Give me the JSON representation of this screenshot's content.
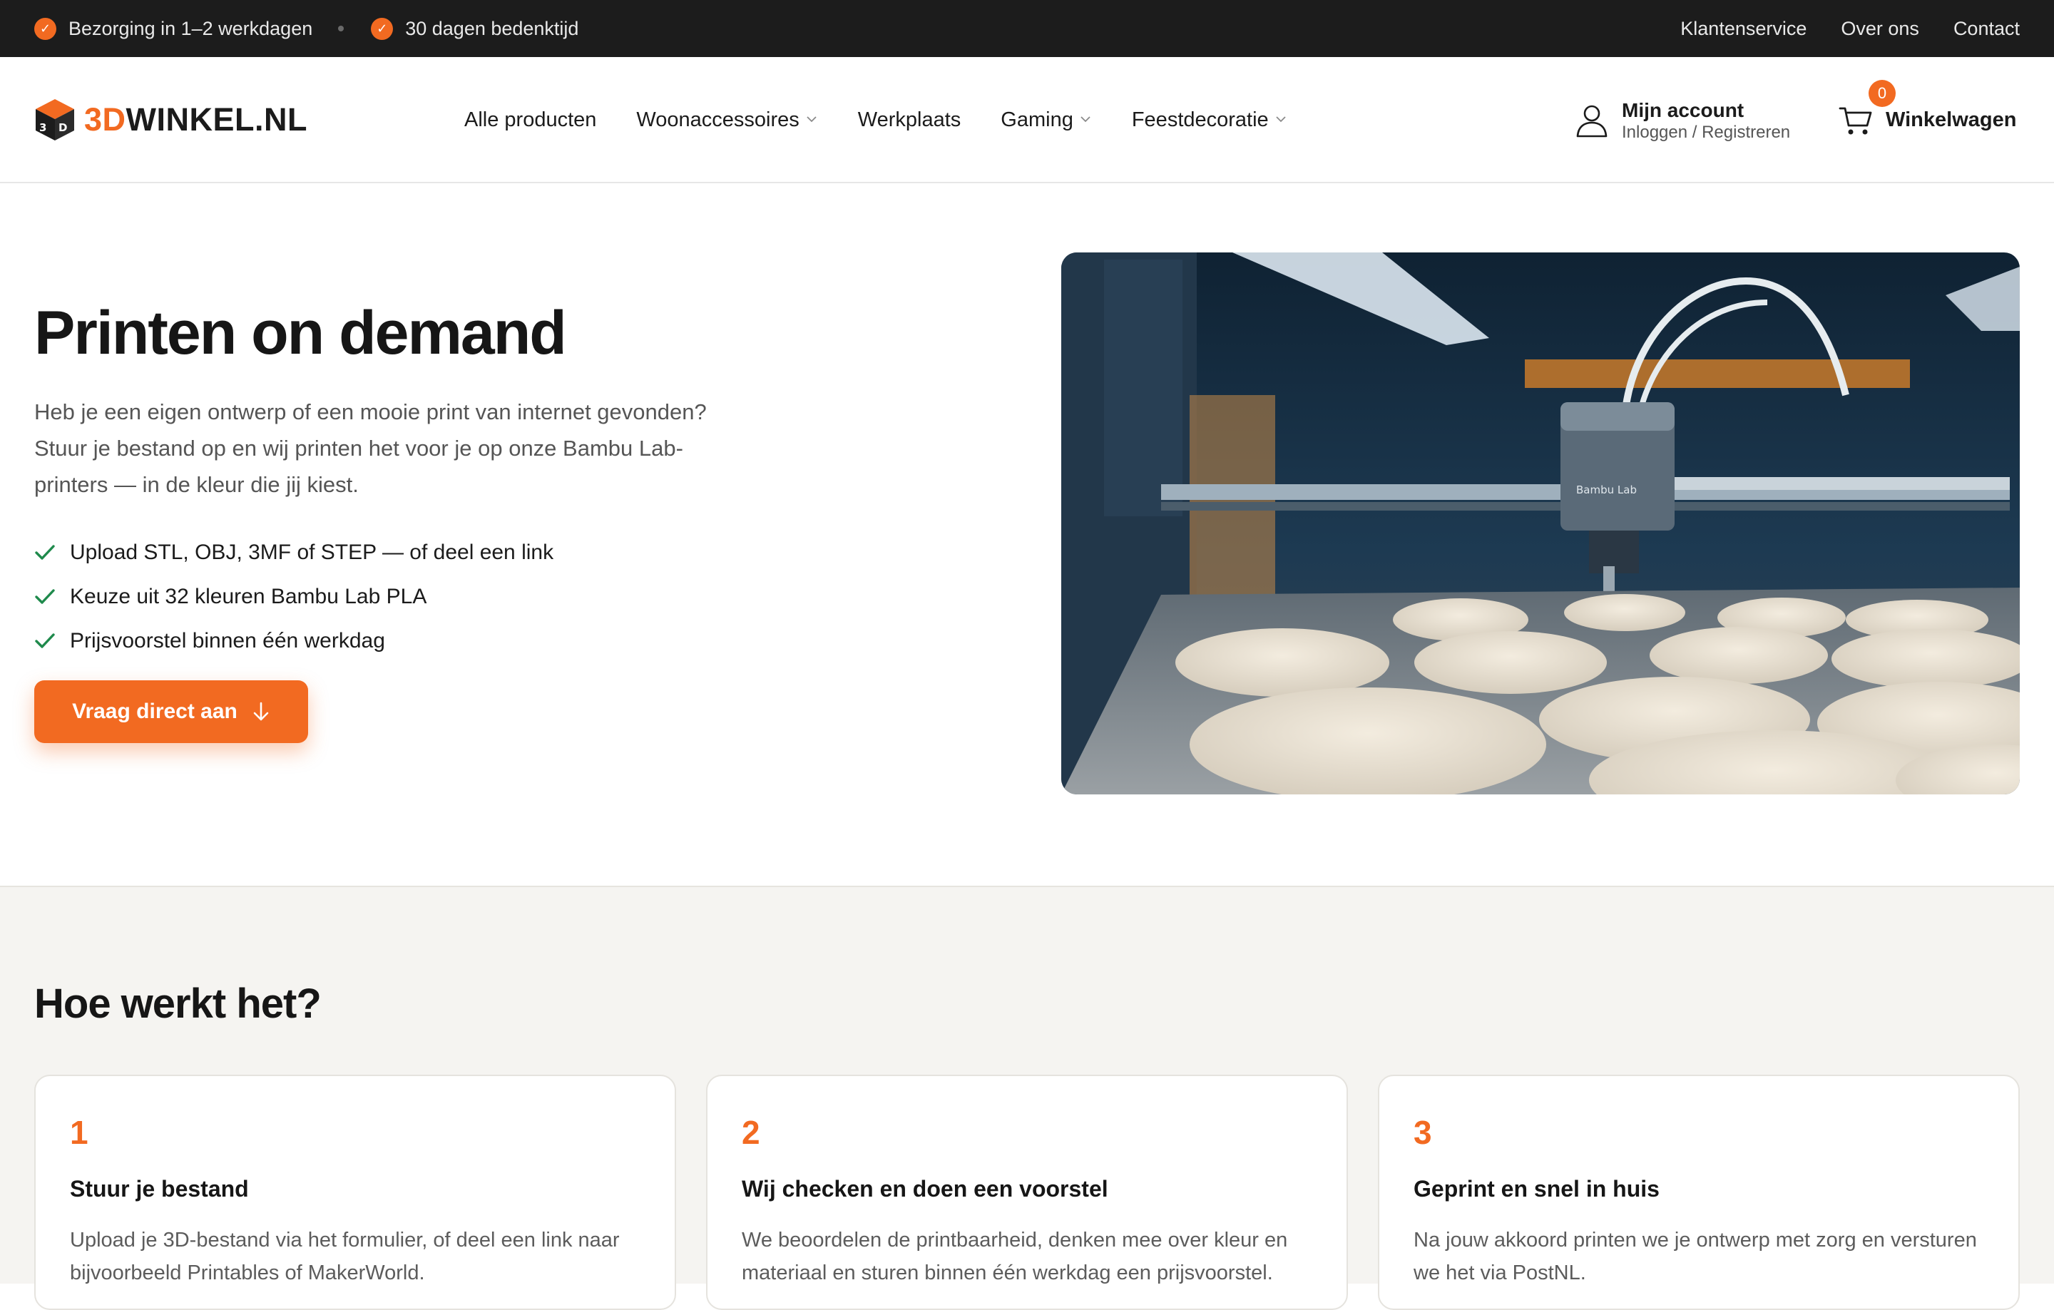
{
  "topbar": {
    "usps": [
      "Bezorging in 1–2 werkdagen",
      "30 dagen bedenktijd"
    ],
    "check_glyph": "✓",
    "links": [
      "Klantenservice",
      "Over ons",
      "Contact"
    ]
  },
  "header": {
    "logo": {
      "accent": "3D",
      "rest": "WINKEL.NL"
    },
    "nav": [
      {
        "label": "Alle producten",
        "has_dropdown": false
      },
      {
        "label": "Woonaccessoires",
        "has_dropdown": true
      },
      {
        "label": "Werkplaats",
        "has_dropdown": false
      },
      {
        "label": "Gaming",
        "has_dropdown": true
      },
      {
        "label": "Feestdecoratie",
        "has_dropdown": true
      }
    ],
    "account": {
      "title": "Mijn account",
      "subtitle": "Inloggen / Registreren"
    },
    "cart": {
      "label": "Winkelwagen",
      "count": "0"
    }
  },
  "hero": {
    "title": "Printen on demand",
    "text": "Heb je een eigen ontwerp of een mooie print van internet gevonden? Stuur je bestand op en wij printen het voor je op onze Bambu Lab-printers — in de kleur die jij kiest.",
    "bullets": [
      "Upload STL, OBJ, 3MF of STEP — of deel een link",
      "Keuze uit 32 kleuren Bambu Lab PLA",
      "Prijsvoorstel binnen één werkdag"
    ],
    "cta": "Vraag direct aan",
    "image_label": "Bambu Lab"
  },
  "how": {
    "title": "Hoe werkt het?",
    "steps": [
      {
        "num": "1",
        "title": "Stuur je bestand",
        "text": "Upload je 3D-bestand via het formulier, of deel een link naar bijvoorbeeld Printables of MakerWorld."
      },
      {
        "num": "2",
        "title": "Wij checken en doen een voorstel",
        "text": "We beoordelen de printbaarheid, denken mee over kleur en materiaal en sturen binnen één werkdag een prijsvoorstel."
      },
      {
        "num": "3",
        "title": "Geprint en snel in huis",
        "text": "Na jouw akkoord printen we je ontwerp met zorg en versturen we het via PostNL."
      }
    ]
  },
  "colors": {
    "accent": "#f26a21",
    "topbar": "#1c1c1c",
    "section_bg": "#f5f4f1",
    "check_green": "#1f8a4c"
  }
}
